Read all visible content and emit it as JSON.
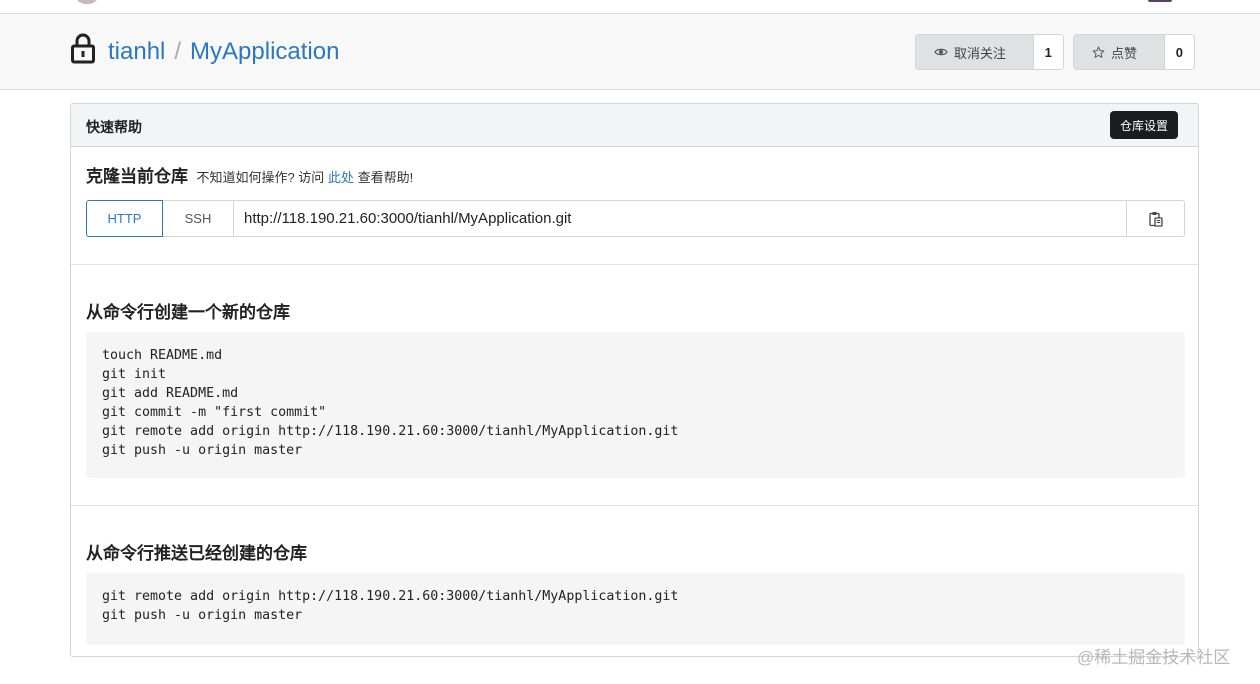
{
  "repo": {
    "owner": "tianhl",
    "separator": "/",
    "name": "MyApplication",
    "watch": {
      "label": "取消关注",
      "count": "1"
    },
    "star": {
      "label": "点赞",
      "count": "0"
    }
  },
  "panel": {
    "title": "快速帮助",
    "settings_label": "仓库设置"
  },
  "clone": {
    "title": "克隆当前仓库",
    "hint_prefix": "不知道如何操作? 访问",
    "hint_link": "此处",
    "hint_suffix": "查看帮助!",
    "protocols": [
      "HTTP",
      "SSH"
    ],
    "active_protocol": "HTTP",
    "url": "http://118.190.21.60:3000/tianhl/MyApplication.git"
  },
  "new_repo": {
    "title": "从命令行创建一个新的仓库",
    "lines": [
      "touch README.md",
      "git init",
      "git add README.md",
      "git commit -m \"first commit\"",
      "git remote add origin http://118.190.21.60:3000/tianhl/MyApplication.git",
      "git push -u origin master"
    ]
  },
  "push_repo": {
    "title": "从命令行推送已经创建的仓库",
    "lines": [
      "git remote add origin http://118.190.21.60:3000/tianhl/MyApplication.git",
      "git push -u origin master"
    ]
  },
  "watermark": "@稀土掘金技术社区",
  "colors": {
    "link": "#2b78c2",
    "settings_button": "#1b1c1d",
    "header_bg": "#f8f8f8",
    "code_bg": "#f5f5f5"
  },
  "icons": {
    "lock": "lock-icon",
    "watch": "eye-icon",
    "star": "star-outline-icon",
    "copy": "clipboard-icon"
  }
}
